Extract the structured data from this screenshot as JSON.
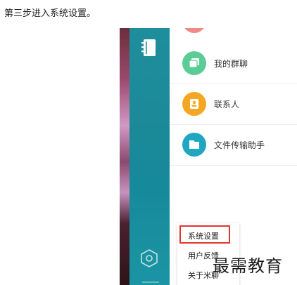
{
  "caption": "第三步进入系统设置。",
  "sidebar": {
    "top_icon": "notebook-icon",
    "bottom_icon": "hexagon-settings-icon"
  },
  "list": {
    "items": [
      {
        "label": "我的群聊",
        "icon": "group-chat-icon",
        "color": "#5ccc96"
      },
      {
        "label": "联系人",
        "icon": "contacts-icon",
        "color": "#f5a623"
      },
      {
        "label": "文件传输助手",
        "icon": "folder-icon",
        "color": "#1fa6c0"
      }
    ]
  },
  "menu": {
    "items": [
      {
        "label": "系统设置"
      },
      {
        "label": "用户反馈"
      },
      {
        "label": "关于米聊"
      }
    ],
    "highlight_color": "#e0342f"
  },
  "watermark": "最需教育"
}
